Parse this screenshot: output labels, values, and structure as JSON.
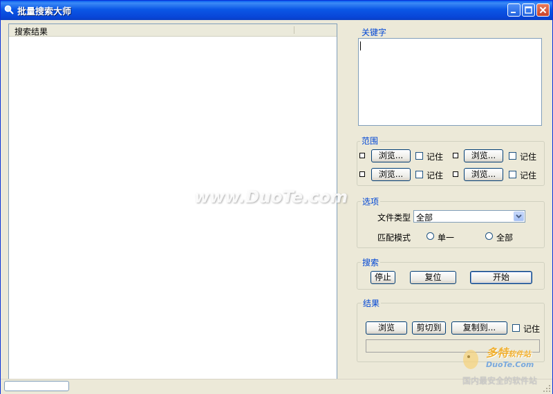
{
  "window": {
    "title": "批量搜索大师"
  },
  "results": {
    "header": "搜索结果"
  },
  "keyword": {
    "group_label": "关键字",
    "value": ""
  },
  "scope": {
    "group_label": "范围",
    "browse_label": "浏览...",
    "remember_label": "记住"
  },
  "options": {
    "group_label": "选项",
    "file_type_label": "文件类型",
    "file_type_value": "全部",
    "match_mode_label": "匹配模式",
    "match_single": "单一",
    "match_all": "全部"
  },
  "search": {
    "group_label": "搜索",
    "stop_label": "停止",
    "reset_label": "复位",
    "start_label": "开始"
  },
  "result_actions": {
    "group_label": "结果",
    "browse_label": "浏览",
    "cut_to_label": "剪切到",
    "copy_to_label": "复制到...",
    "remember_label": "记住"
  },
  "watermark": {
    "text": "www.DuoTe.com",
    "logo_cn": "多特",
    "logo_sub": "软件站",
    "logo_en": "DuoTe.Com",
    "logo_slogan": "国内最安全的软件站"
  },
  "colors": {
    "titlebar": "#0a50e0",
    "group_label": "#0046d5",
    "background": "#ece9d8"
  }
}
